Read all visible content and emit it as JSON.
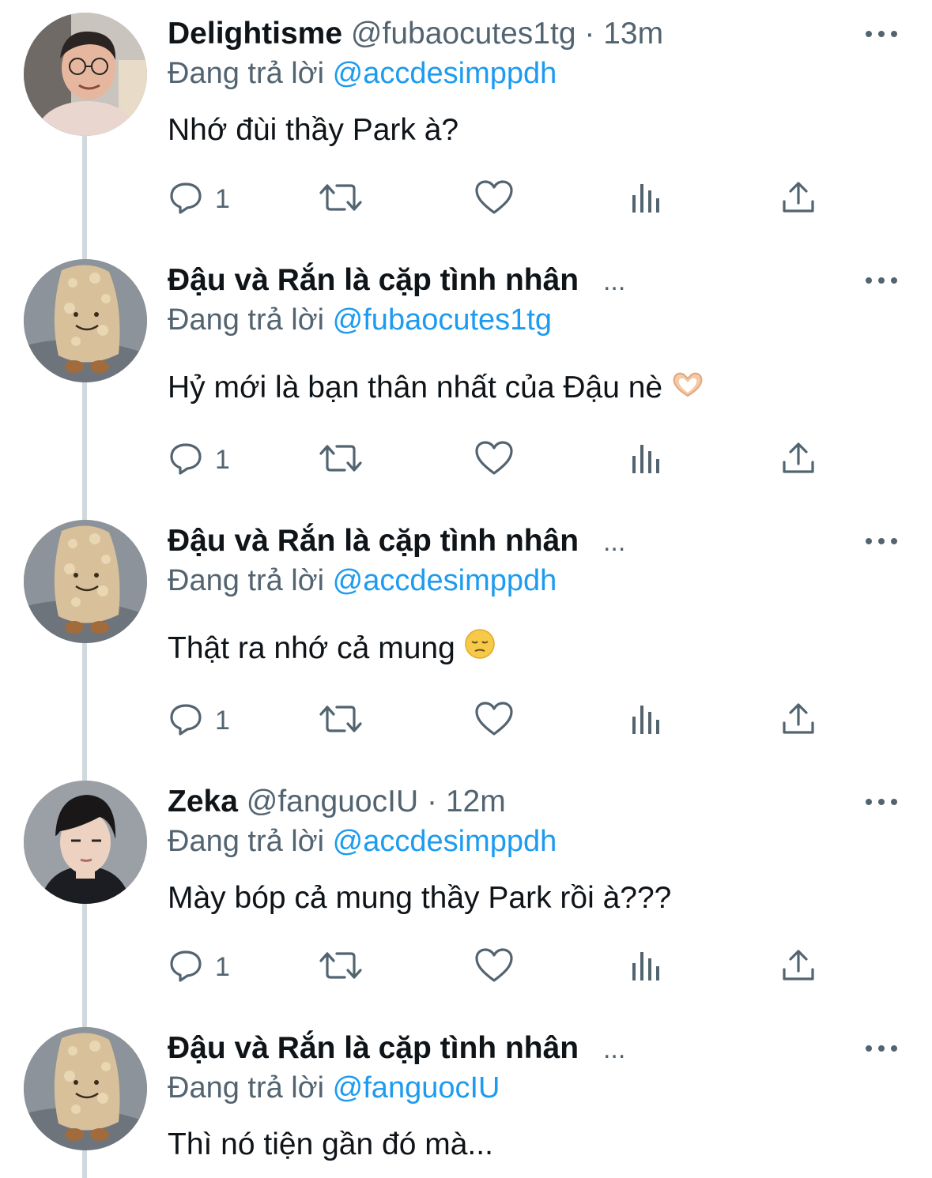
{
  "tweets": [
    {
      "name": "Delightisme",
      "handle": "@fubaocutes1tg",
      "time": "13m",
      "replying_label": "Đang trả lời",
      "reply_to": "@accdesimppdh",
      "text": "Nhớ đùi thầy Park à?",
      "reply_count": "1",
      "avatar": "person-glasses"
    },
    {
      "name": "Đậu và Rắn là cặp tình nhân",
      "name_suffix": "...",
      "replying_label": "Đang trả lời",
      "reply_to": "@fubaocutes1tg",
      "text": "Hỷ mới là bạn thân nhất của Đậu nè",
      "emoji": "heart-hands",
      "reply_count": "1",
      "avatar": "plush-toy"
    },
    {
      "name": "Đậu và Rắn là cặp tình nhân",
      "name_suffix": "...",
      "replying_label": "Đang trả lời",
      "reply_to": "@accdesimppdh",
      "text": "Thật ra nhớ cả mung",
      "emoji": "pensive-face",
      "reply_count": "1",
      "avatar": "plush-toy"
    },
    {
      "name": "Zeka",
      "handle": "@fanguocIU",
      "time": "12m",
      "replying_label": "Đang trả lời",
      "reply_to": "@accdesimppdh",
      "text": "Mày bóp cả mung thầy Park rồi à???",
      "reply_count": "1",
      "avatar": "person-dark-hair"
    },
    {
      "name": "Đậu và Rắn là cặp tình nhân",
      "name_suffix": "...",
      "replying_label": "Đang trả lời",
      "reply_to": "@fanguocIU",
      "text": "Thì nó tiện gần đó mà...",
      "avatar": "plush-toy"
    }
  ],
  "colors": {
    "text": "#0f1419",
    "secondary": "#536471",
    "accent": "#1d9bf0",
    "thread_line": "#cfd9de"
  },
  "icons": [
    "reply-icon",
    "retweet-icon",
    "like-icon",
    "views-icon",
    "share-icon",
    "more-icon"
  ]
}
